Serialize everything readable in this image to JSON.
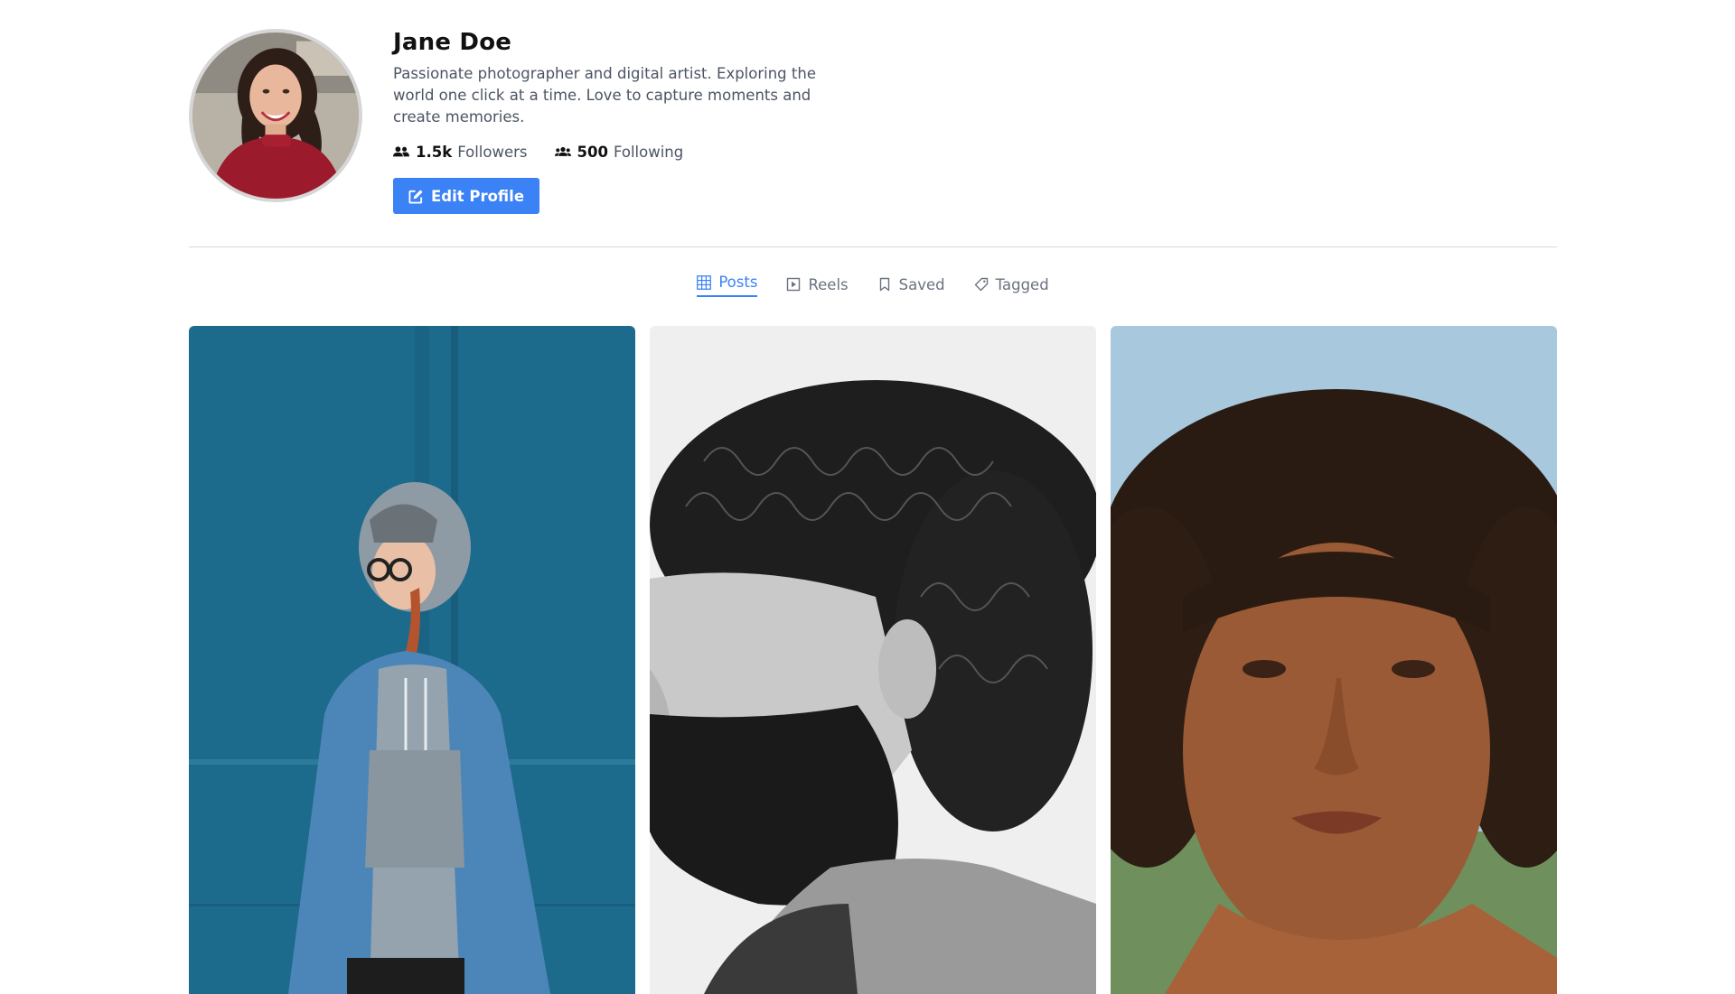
{
  "profile": {
    "name": "Jane Doe",
    "bio": "Passionate photographer and digital artist. Exploring the world one click at a time. Love to capture moments and create memories.",
    "followers": {
      "count": "1.5k",
      "label": "Followers",
      "icon": "user-friends-icon"
    },
    "following": {
      "count": "500",
      "label": "Following",
      "icon": "users-icon"
    },
    "edit_button": {
      "label": "Edit Profile",
      "icon": "edit-icon"
    }
  },
  "tabs": [
    {
      "label": "Posts",
      "icon": "grid-icon",
      "active": true
    },
    {
      "label": "Reels",
      "icon": "play-square-icon",
      "active": false
    },
    {
      "label": "Saved",
      "icon": "bookmark-icon",
      "active": false
    },
    {
      "label": "Tagged",
      "icon": "tag-icon",
      "active": false
    }
  ],
  "posts": [
    {
      "subject": "woman in grey hoodie and denim jacket against blue wall"
    },
    {
      "subject": "black and white profile of bearded man with curly hair"
    },
    {
      "subject": "close-up portrait of woman with curly hair"
    }
  ],
  "colors": {
    "accent": "#3b82f6",
    "text_muted": "#4b5563",
    "tab_inactive": "#6b7280"
  }
}
